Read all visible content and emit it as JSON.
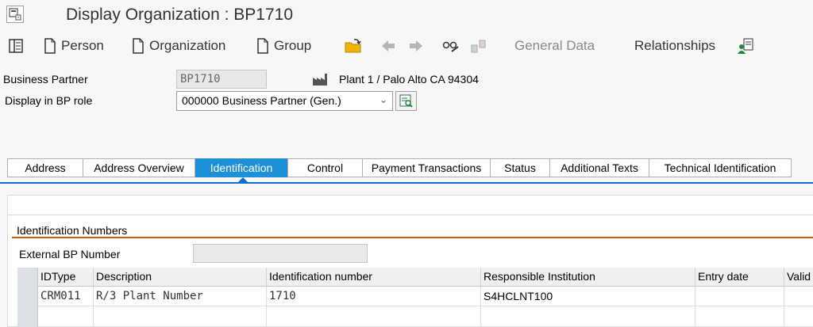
{
  "title": "Display Organization : BP1710",
  "toolbar": {
    "person": "Person",
    "organization": "Organization",
    "group": "Group",
    "general_data": "General Data",
    "relationships": "Relationships"
  },
  "header": {
    "bp_label": "Business Partner",
    "bp_value": "BP1710",
    "bp_description": "Plant 1 / Palo Alto CA 94304",
    "role_label": "Display in BP role",
    "role_value": "000000 Business Partner (Gen.)"
  },
  "tabs": [
    {
      "label": "Address"
    },
    {
      "label": "Address Overview"
    },
    {
      "label": "Identification"
    },
    {
      "label": "Control"
    },
    {
      "label": "Payment Transactions"
    },
    {
      "label": "Status"
    },
    {
      "label": "Additional Texts"
    },
    {
      "label": "Technical Identification"
    }
  ],
  "active_tab": "Identification",
  "identification": {
    "group_title": "Identification Numbers",
    "external_bp_label": "External BP Number",
    "external_bp_value": "",
    "columns": [
      "IDType",
      "Description",
      "Identification number",
      "Responsible Institution",
      "Entry date",
      "Valid"
    ],
    "rows": [
      {
        "idtype": "CRM011",
        "description": "R/3 Plant Number",
        "id_number": "1710",
        "institution": "S4HCLNT100",
        "entry_date": "",
        "valid": ""
      }
    ]
  },
  "colors": {
    "accent": "#0a6ed1",
    "active_tab": "#1e90d6",
    "group_line": "#d3560f"
  }
}
